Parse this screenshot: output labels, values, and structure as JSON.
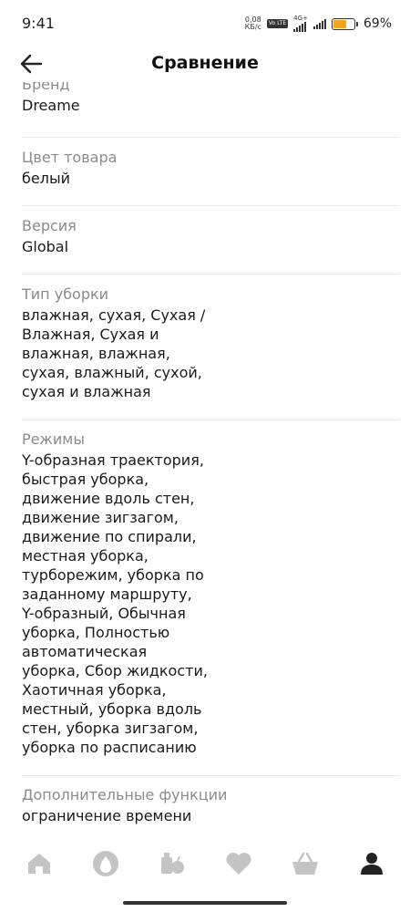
{
  "status_bar": {
    "time": "9:41",
    "net_speed_value": "0,08",
    "net_speed_unit": "КБ/с",
    "volte": "Vo LTE",
    "net_type": "4G+",
    "battery_percent": "69%",
    "battery_level": 0.69,
    "battery_color": "#f2a51c"
  },
  "header": {
    "title": "Сравнение",
    "back_icon": "arrow-left-icon"
  },
  "specs": [
    {
      "label": "Бренд",
      "value": "Dreame"
    },
    {
      "label": "Цвет товара",
      "value": "белый"
    },
    {
      "label": "Версия",
      "value": "Global"
    },
    {
      "label": "Тип уборки",
      "value_lines": [
        "влажная, сухая, Сухая /",
        "Влажная, Сухая и",
        "влажная, влажная,",
        "сухая, влажный, сухой,",
        "сухая и влажная"
      ]
    },
    {
      "label": "Режимы",
      "value_lines": [
        "Y-образная траектория,",
        "быстрая уборка,",
        "движение вдоль стен,",
        "движение зигзагом,",
        "движение по спирали,",
        "местная уборка,",
        "турборежим, уборка по",
        "заданному маршруту,",
        "Y-образный, Обычная",
        "уборка, Полностью",
        "автоматическая",
        "уборка, Сбор жидкости,",
        "Хаотичная уборка,",
        "местный, уборка вдоль",
        "стен, уборка зигзагом,",
        "уборка по расписанию"
      ]
    },
    {
      "label": "Дополнительные функции",
      "value_lines": [
        "ограничение времени"
      ]
    }
  ],
  "bottom_nav": [
    {
      "icon": "home-icon",
      "active": false
    },
    {
      "icon": "assistant-icon",
      "active": false
    },
    {
      "icon": "products-icon",
      "active": false
    },
    {
      "icon": "heart-icon",
      "active": false
    },
    {
      "icon": "cart-icon",
      "active": false
    },
    {
      "icon": "profile-icon",
      "active": true
    }
  ],
  "colors": {
    "label": "#8b8b8b",
    "value": "#1a1a1a",
    "nav_inactive": "#c4c4c4",
    "nav_active": "#222222"
  }
}
